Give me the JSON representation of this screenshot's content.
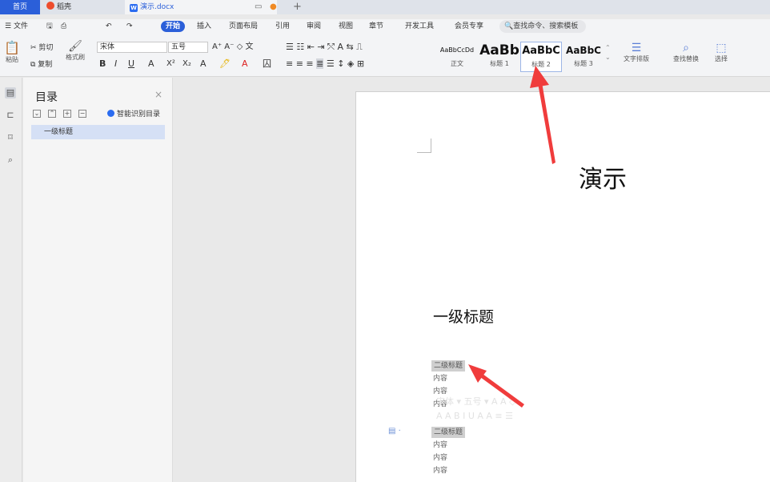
{
  "tabs": {
    "home": "首页",
    "daoke": "稻壳",
    "doc": "演示.docx",
    "add": "+"
  },
  "menu": {
    "file": "文件",
    "items": [
      "开始",
      "插入",
      "页面布局",
      "引用",
      "审阅",
      "视图",
      "章节",
      "开发工具",
      "会员专享"
    ],
    "search": "查找命令、搜索模板"
  },
  "ribbon": {
    "paste": "粘贴",
    "cut": "剪切",
    "copy": "复制",
    "format_painter": "格式刷",
    "font_name": "宋体",
    "font_size": "五号",
    "styles": [
      {
        "sample": "AaBbCcDd",
        "label": "正文"
      },
      {
        "sample": "AaBb",
        "label": "标题 1"
      },
      {
        "sample": "AaBbC",
        "label": "标题 2"
      },
      {
        "sample": "AaBbC",
        "label": "标题 3"
      }
    ],
    "text_layout": "文字排版",
    "find_replace": "查找替换",
    "select": "选择"
  },
  "toc": {
    "title": "目录",
    "close": "×",
    "smart": "智能识别目录",
    "items": [
      "一级标题"
    ]
  },
  "document": {
    "demo": "演示",
    "heading1": "一级标题",
    "lines": [
      "二级标题",
      "内容",
      "内容",
      "内容",
      "二级标题",
      "内容",
      "内容",
      "内容"
    ]
  },
  "colors": {
    "accent": "#2b5fd9",
    "arrow": "#f03c3c",
    "selection": "#d5e0f5"
  }
}
